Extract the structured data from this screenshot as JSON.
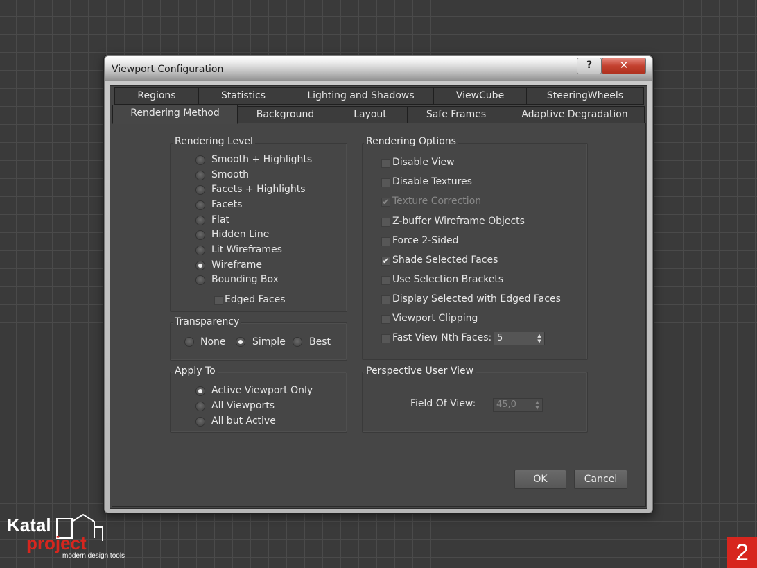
{
  "window": {
    "title": "Viewport Configuration",
    "help": "?",
    "close": "✕"
  },
  "tabs_row1": [
    "Regions",
    "Statistics",
    "Lighting and Shadows",
    "ViewCube",
    "SteeringWheels"
  ],
  "tabs_row2": [
    "Rendering Method",
    "Background",
    "Layout",
    "Safe Frames",
    "Adaptive Degradation"
  ],
  "active_tab": "Rendering Method",
  "rendering_level": {
    "title": "Rendering Level",
    "options": [
      "Smooth + Highlights",
      "Smooth",
      "Facets + Highlights",
      "Facets",
      "Flat",
      "Hidden Line",
      "Lit Wireframes",
      "Wireframe",
      "Bounding Box"
    ],
    "selected": "Wireframe",
    "edged_faces": {
      "label": "Edged Faces",
      "checked": false
    }
  },
  "transparency": {
    "title": "Transparency",
    "options": [
      "None",
      "Simple",
      "Best"
    ],
    "selected": "Simple"
  },
  "apply_to": {
    "title": "Apply To",
    "options": [
      "Active Viewport Only",
      "All Viewports",
      "All but Active"
    ],
    "selected": "Active Viewport Only"
  },
  "rendering_options": {
    "title": "Rendering Options",
    "items": [
      {
        "label": "Disable View",
        "checked": false,
        "disabled": false
      },
      {
        "label": "Disable Textures",
        "checked": false,
        "disabled": false
      },
      {
        "label": "Texture Correction",
        "checked": true,
        "disabled": true
      },
      {
        "label": "Z-buffer Wireframe Objects",
        "checked": false,
        "disabled": false
      },
      {
        "label": "Force 2-Sided",
        "checked": false,
        "disabled": false
      },
      {
        "label": "Shade Selected Faces",
        "checked": true,
        "disabled": false
      },
      {
        "label": "Use Selection Brackets",
        "checked": false,
        "disabled": false
      },
      {
        "label": "Display Selected with Edged Faces",
        "checked": false,
        "disabled": false
      },
      {
        "label": "Viewport Clipping",
        "checked": false,
        "disabled": false
      },
      {
        "label": "Fast View Nth Faces:",
        "checked": false,
        "disabled": false
      }
    ],
    "nth_faces_value": "5"
  },
  "perspective": {
    "title": "Perspective User View",
    "fov_label": "Field Of View:",
    "fov_value": "45,0"
  },
  "buttons": {
    "ok": "OK",
    "cancel": "Cancel"
  },
  "branding": {
    "logo_line1": "Katal",
    "logo_line2": "project",
    "logo_tagline": "modern design tools",
    "page_number": "2"
  },
  "colors": {
    "accent_red": "#d7261e",
    "panel": "#464646",
    "close_red": "#c3412f"
  }
}
